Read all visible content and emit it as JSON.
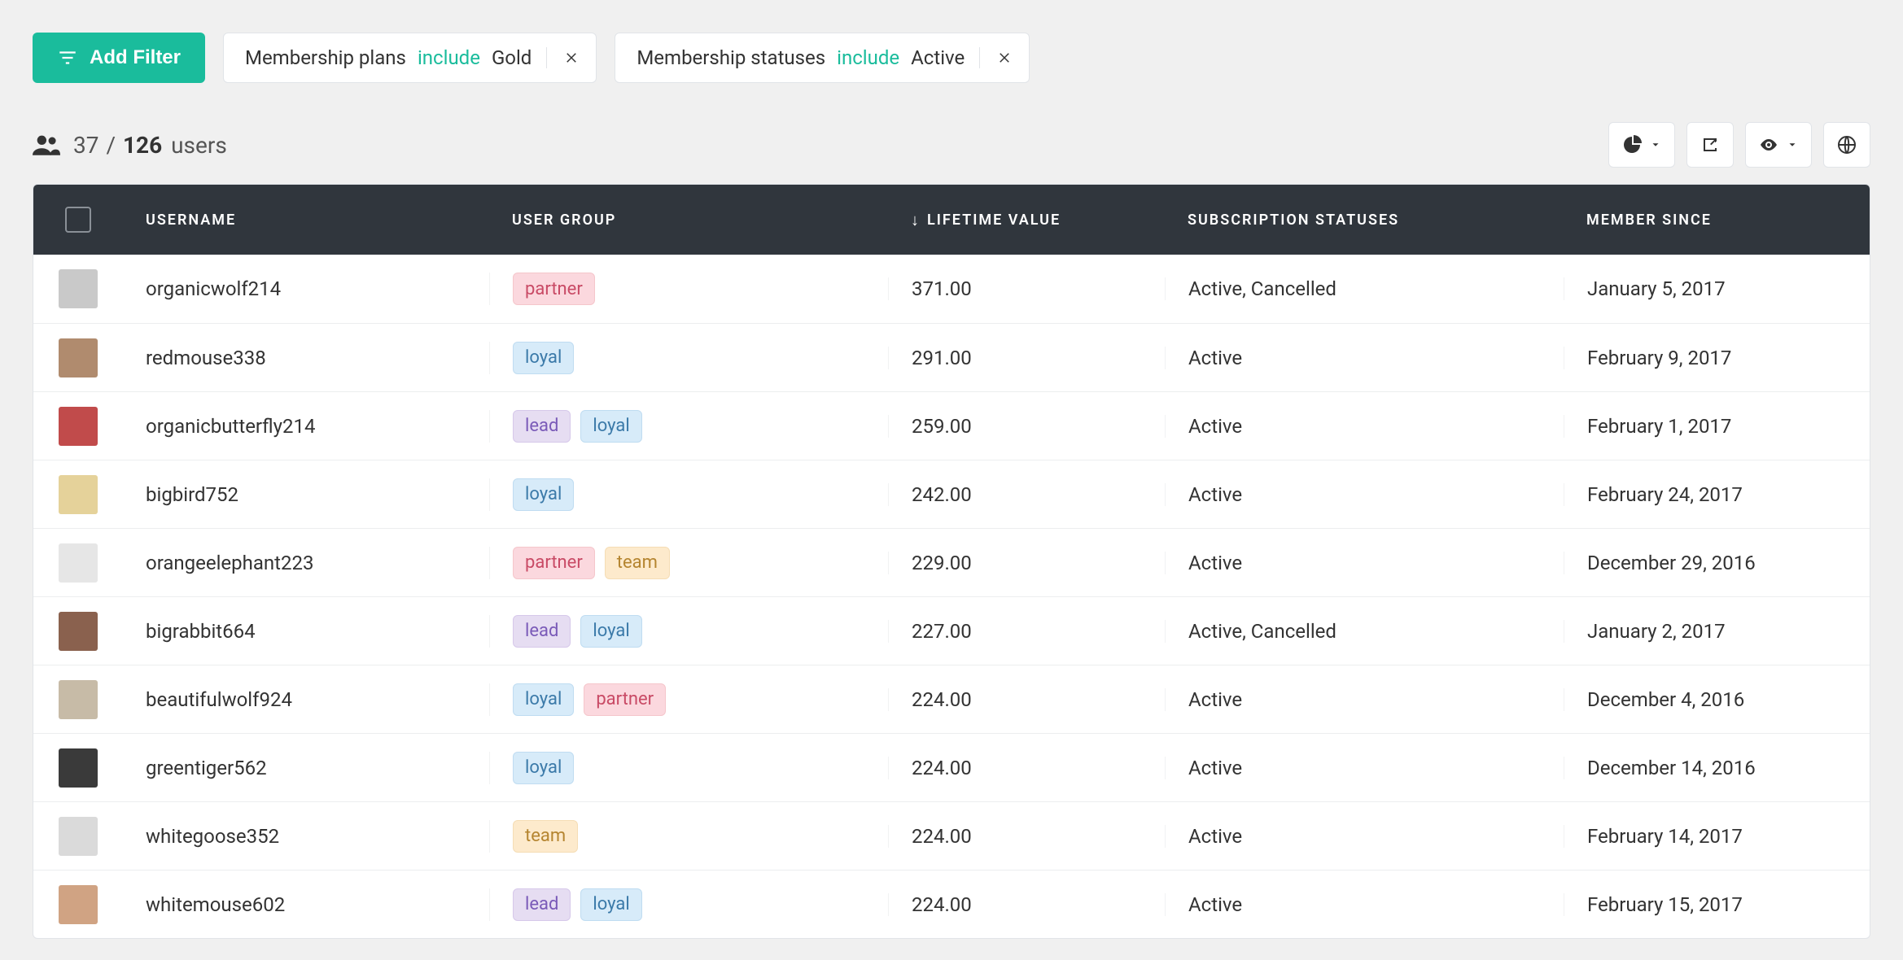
{
  "toolbar": {
    "add_filter_label": "Add Filter",
    "chips": [
      {
        "field": "Membership plans",
        "op": "include",
        "value": "Gold"
      },
      {
        "field": "Membership statuses",
        "op": "include",
        "value": "Active"
      }
    ]
  },
  "header": {
    "filtered_count": "37",
    "separator": "/",
    "total_count": "126",
    "users_label": "users"
  },
  "columns": {
    "username": "USERNAME",
    "user_group": "USER GROUP",
    "lifetime_value": "LIFETIME VALUE",
    "lifetime_value_sort_glyph": "↓",
    "subscription_statuses": "SUBSCRIPTION STATUSES",
    "member_since": "MEMBER SINCE"
  },
  "tags": {
    "partner": "partner",
    "loyal": "loyal",
    "lead": "lead",
    "team": "team"
  },
  "rows": [
    {
      "username": "organicwolf214",
      "groups": [
        "partner"
      ],
      "lifetime_value": "371.00",
      "subscription_statuses": "Active, Cancelled",
      "member_since": "January 5, 2017",
      "avatar_color": "#c9c9c9"
    },
    {
      "username": "redmouse338",
      "groups": [
        "loyal"
      ],
      "lifetime_value": "291.00",
      "subscription_statuses": "Active",
      "member_since": "February 9, 2017",
      "avatar_color": "#b08b6e"
    },
    {
      "username": "organicbutterfly214",
      "groups": [
        "lead",
        "loyal"
      ],
      "lifetime_value": "259.00",
      "subscription_statuses": "Active",
      "member_since": "February 1, 2017",
      "avatar_color": "#c14b4b"
    },
    {
      "username": "bigbird752",
      "groups": [
        "loyal"
      ],
      "lifetime_value": "242.00",
      "subscription_statuses": "Active",
      "member_since": "February 24, 2017",
      "avatar_color": "#e5d29a"
    },
    {
      "username": "orangeelephant223",
      "groups": [
        "partner",
        "team"
      ],
      "lifetime_value": "229.00",
      "subscription_statuses": "Active",
      "member_since": "December 29, 2016",
      "avatar_color": "#e6e6e6"
    },
    {
      "username": "bigrabbit664",
      "groups": [
        "lead",
        "loyal"
      ],
      "lifetime_value": "227.00",
      "subscription_statuses": "Active, Cancelled",
      "member_since": "January 2, 2017",
      "avatar_color": "#8a614e"
    },
    {
      "username": "beautifulwolf924",
      "groups": [
        "loyal",
        "partner"
      ],
      "lifetime_value": "224.00",
      "subscription_statuses": "Active",
      "member_since": "December 4, 2016",
      "avatar_color": "#c7bba7"
    },
    {
      "username": "greentiger562",
      "groups": [
        "loyal"
      ],
      "lifetime_value": "224.00",
      "subscription_statuses": "Active",
      "member_since": "December 14, 2016",
      "avatar_color": "#3a3a3a"
    },
    {
      "username": "whitegoose352",
      "groups": [
        "team"
      ],
      "lifetime_value": "224.00",
      "subscription_statuses": "Active",
      "member_since": "February 14, 2017",
      "avatar_color": "#dadada"
    },
    {
      "username": "whitemouse602",
      "groups": [
        "lead",
        "loyal"
      ],
      "lifetime_value": "224.00",
      "subscription_statuses": "Active",
      "member_since": "February 15, 2017",
      "avatar_color": "#d0a383"
    }
  ]
}
